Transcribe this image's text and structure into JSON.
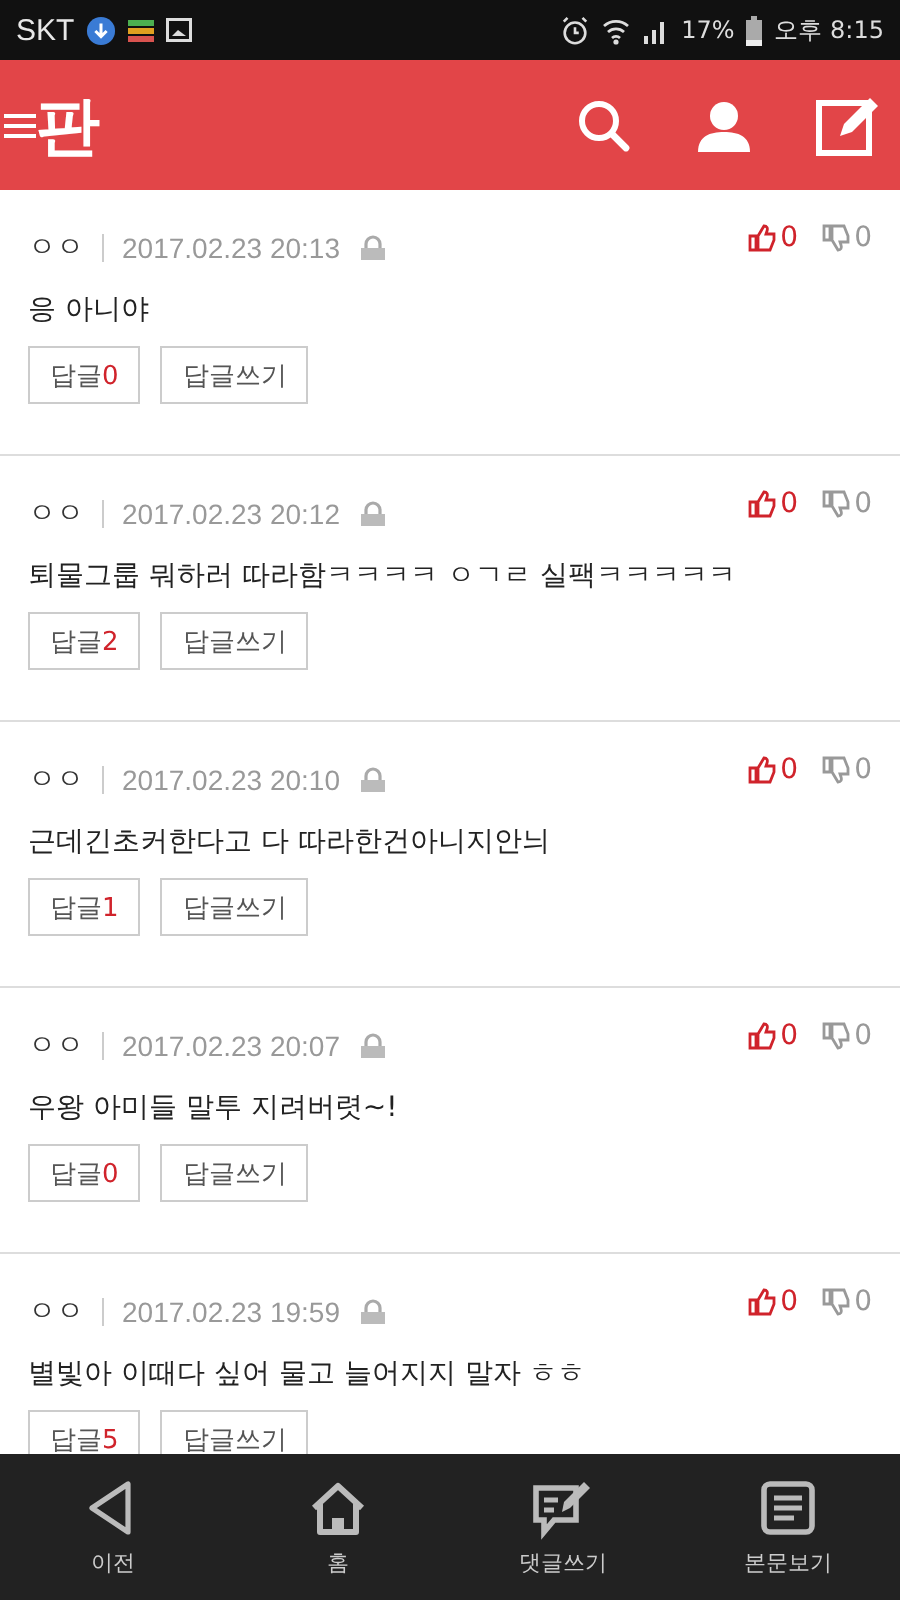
{
  "status_bar": {
    "carrier": "SKT",
    "battery": "17%",
    "time": "오후 8:15"
  },
  "header": {
    "logo": "판"
  },
  "comments": [
    {
      "author": "ㅇㅇ",
      "date": "2017.02.23 20:13",
      "likes": "0",
      "dislikes": "0",
      "text": "응 아니야",
      "reply_label": "답글",
      "reply_count": "0",
      "write_reply": "답글쓰기"
    },
    {
      "author": "ㅇㅇ",
      "date": "2017.02.23 20:12",
      "likes": "0",
      "dislikes": "0",
      "text": "퇴물그룹 뭐하러 따라함ㅋㅋㅋㅋ ㅇㄱㄹ 실팩ㅋㅋㅋㅋㅋ",
      "reply_label": "답글",
      "reply_count": "2",
      "write_reply": "답글쓰기"
    },
    {
      "author": "ㅇㅇ",
      "date": "2017.02.23 20:10",
      "likes": "0",
      "dislikes": "0",
      "text": "근데긴초커한다고 다 따라한건아니지안늬",
      "reply_label": "답글",
      "reply_count": "1",
      "write_reply": "답글쓰기"
    },
    {
      "author": "ㅇㅇ",
      "date": "2017.02.23 20:07",
      "likes": "0",
      "dislikes": "0",
      "text": "우왕 아미들 말투 지려버렷~!",
      "reply_label": "답글",
      "reply_count": "0",
      "write_reply": "답글쓰기"
    },
    {
      "author": "ㅇㅇ",
      "date": "2017.02.23 19:59",
      "likes": "0",
      "dislikes": "0",
      "text": "별빛아 이때다 싶어 물고 늘어지지 말자 ㅎㅎ",
      "reply_label": "답글",
      "reply_count": "5",
      "write_reply": "답글쓰기"
    }
  ],
  "bottom_nav": [
    {
      "kind": "back",
      "label": "이전"
    },
    {
      "kind": "home",
      "label": "홈"
    },
    {
      "kind": "comment",
      "label": "댓글쓰기"
    },
    {
      "kind": "article",
      "label": "본문보기"
    }
  ]
}
